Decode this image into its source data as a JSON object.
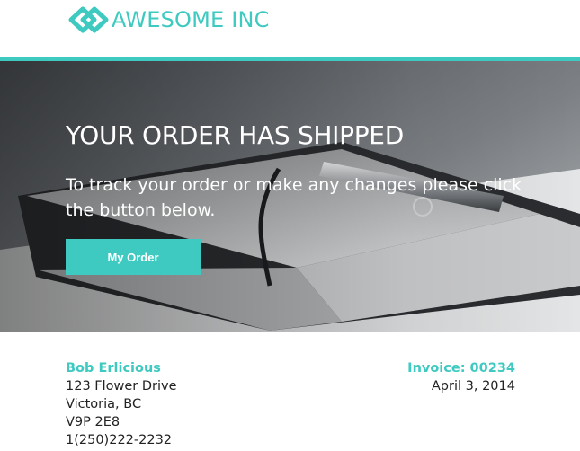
{
  "header": {
    "brand": "AWESOME INC",
    "logo_icon": "diamond-logo-icon"
  },
  "hero": {
    "title": "YOUR ORDER HAS SHIPPED",
    "text": "To track your order or make any changes please click the button below.",
    "button_label": "My Order"
  },
  "customer": {
    "name": "Bob Erlicious",
    "street": "123 Flower Drive",
    "city": "Victoria, BC",
    "postal": "V9P 2E8",
    "phone": "1(250)222-2232"
  },
  "invoice": {
    "number": "Invoice: 00234",
    "date": "April 3, 2014"
  },
  "colors": {
    "accent": "#3ecac0",
    "text": "#222222"
  }
}
